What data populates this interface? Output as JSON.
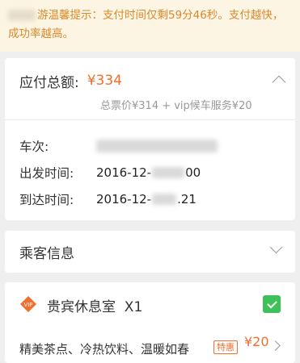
{
  "notice": {
    "text": "游温馨提示：支付时间仅剩59分46秒。支付越快，成功率越高。"
  },
  "order": {
    "total_label": "应付总额:",
    "total_price": "¥334",
    "breakdown": "总票价¥314 + vip候车服务¥20",
    "train_label": "车次:",
    "depart_label": "出发时间:",
    "depart_value": "2016-12-",
    "depart_suffix": "00",
    "arrive_label": "到达时间:",
    "arrive_value": "2016-12-",
    "arrive_suffix": ".21"
  },
  "passenger": {
    "label": "乘客信息"
  },
  "vip": {
    "icon_text": "VIP",
    "title": "贵宾休息室  X1",
    "desc": "精美茶点、冷热饮料、温暖如春",
    "tag": "特惠",
    "price": "¥20"
  },
  "colors": {
    "accent": "#f06f2f",
    "notice_text": "#d9882a",
    "notice_bg": "#fdf5e3",
    "check_green": "#3fc15a"
  }
}
